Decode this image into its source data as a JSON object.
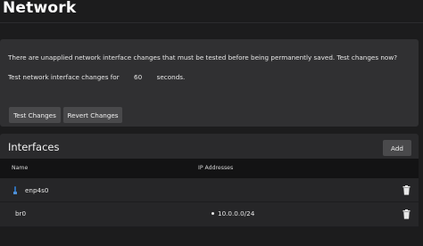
{
  "page": {
    "title": "Network"
  },
  "pending_changes": {
    "message": "There are unapplied network interface changes that must be tested before being permanently saved. Test changes now?",
    "timeout_prefix": "Test network interface changes for",
    "timeout_value": "60",
    "timeout_suffix": "seconds.",
    "test_button_label": "Test Changes",
    "revert_button_label": "Revert Changes"
  },
  "interfaces": {
    "title": "Interfaces",
    "add_button_label": "Add",
    "columns": [
      "Name",
      "IP Addresses"
    ],
    "rows": [
      {
        "name": "enp4s0",
        "icon": "link-icon",
        "ip_addresses": []
      },
      {
        "name": "br0",
        "icon": "",
        "ip_addresses": [
          "10.0.0.0/24"
        ]
      }
    ]
  },
  "colors": {
    "background": "#1c1c1d",
    "card": "#303032",
    "table_header": "#131314",
    "row": "#262628",
    "button": "#49494b",
    "link_icon": "#2f6fb5"
  }
}
